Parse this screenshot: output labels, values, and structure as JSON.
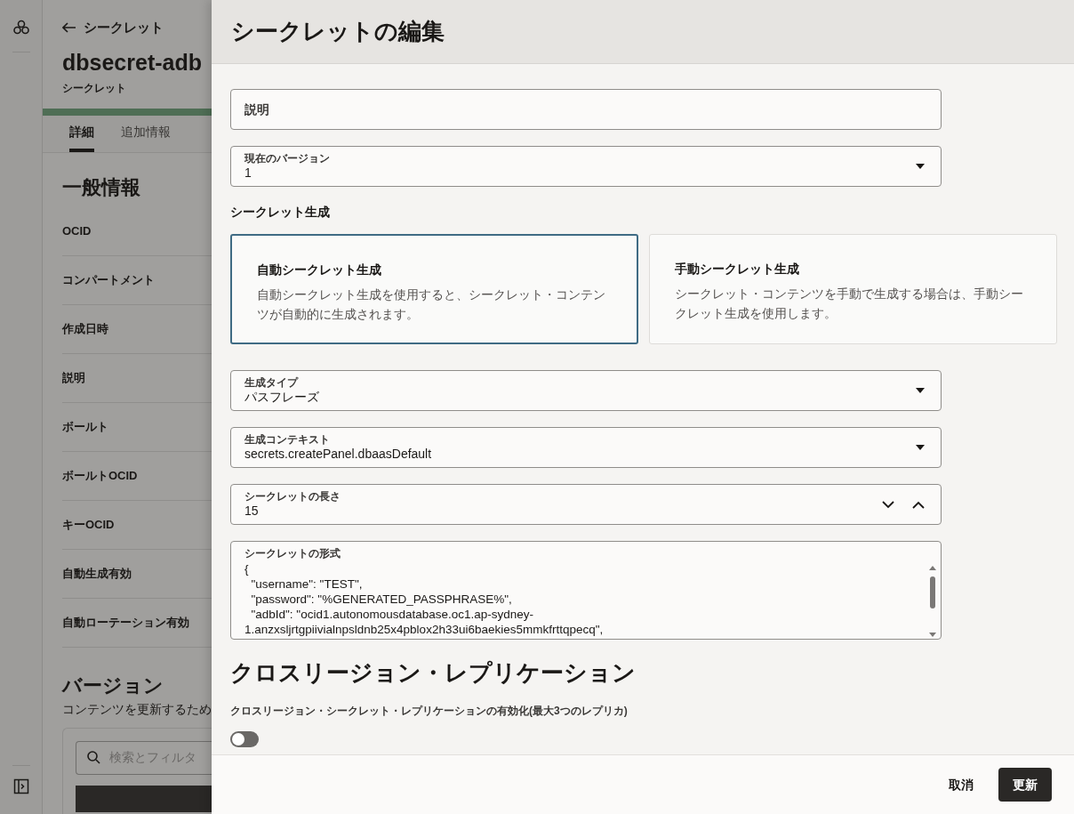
{
  "background_page": {
    "back_link": "シークレット",
    "title": "dbsecret-adb",
    "subtitle": "シークレット",
    "tabs": [
      {
        "label": "詳細",
        "selected": true
      },
      {
        "label": "追加情報",
        "selected": false
      }
    ],
    "section_title": "一般情報",
    "fields": [
      "OCID",
      "コンパートメント",
      "作成日時",
      "説明",
      "ボールト",
      "ボールトOCID",
      "キーOCID",
      "自動生成有効",
      "自動ローテーション有効"
    ],
    "versions_title": "バージョン",
    "versions_description": "コンテンツを更新するため",
    "search": {
      "placeholder": "検索とフィルタ"
    }
  },
  "drawer": {
    "title": "シークレットの編集",
    "top_fields": [
      {
        "kind": "text",
        "placeholder": "説明"
      },
      {
        "kind": "select",
        "label": "現在のバージョン",
        "value": "1"
      }
    ],
    "generation_heading": "シークレット生成",
    "generation_options": [
      {
        "title": "自動シークレット生成",
        "description": "自動シークレット生成を使用すると、シークレット・コンテンツが自動的に生成されます。",
        "selected": true
      },
      {
        "title": "手動シークレット生成",
        "description": "シークレット・コンテンツを手動で生成する場合は、手動シークレット生成を使用します。",
        "selected": false
      }
    ],
    "fields": [
      {
        "kind": "select",
        "label": "生成タイプ",
        "value": "パスフレーズ"
      },
      {
        "kind": "select",
        "label": "生成コンテキスト",
        "value": "secrets.createPanel.dbaasDefault"
      },
      {
        "kind": "number",
        "label": "シークレットの長さ",
        "value": "15"
      },
      {
        "kind": "textarea",
        "label": "シークレットの形式",
        "lines": [
          "{",
          "  \"username\": \"TEST\",",
          "  \"password\": \"%GENERATED_PASSPHRASE%\",",
          "  \"adbId\": \"ocid1.autonomousdatabase.oc1.ap-sydney-",
          "1.anzxsljrtgpiivialnpsldnb25x4pblox2h33ui6baekies5mmkfrttqpecq\","
        ]
      }
    ],
    "replication_heading": "クロスリージョン・レプリケーション",
    "replication_toggle": {
      "label": "クロスリージョン・シークレット・レプリケーションの有効化(最大3つのレプリカ)",
      "on": false
    },
    "buttons": [
      {
        "label": "取消",
        "kind": "secondary"
      },
      {
        "label": "更新",
        "kind": "primary"
      }
    ]
  }
}
